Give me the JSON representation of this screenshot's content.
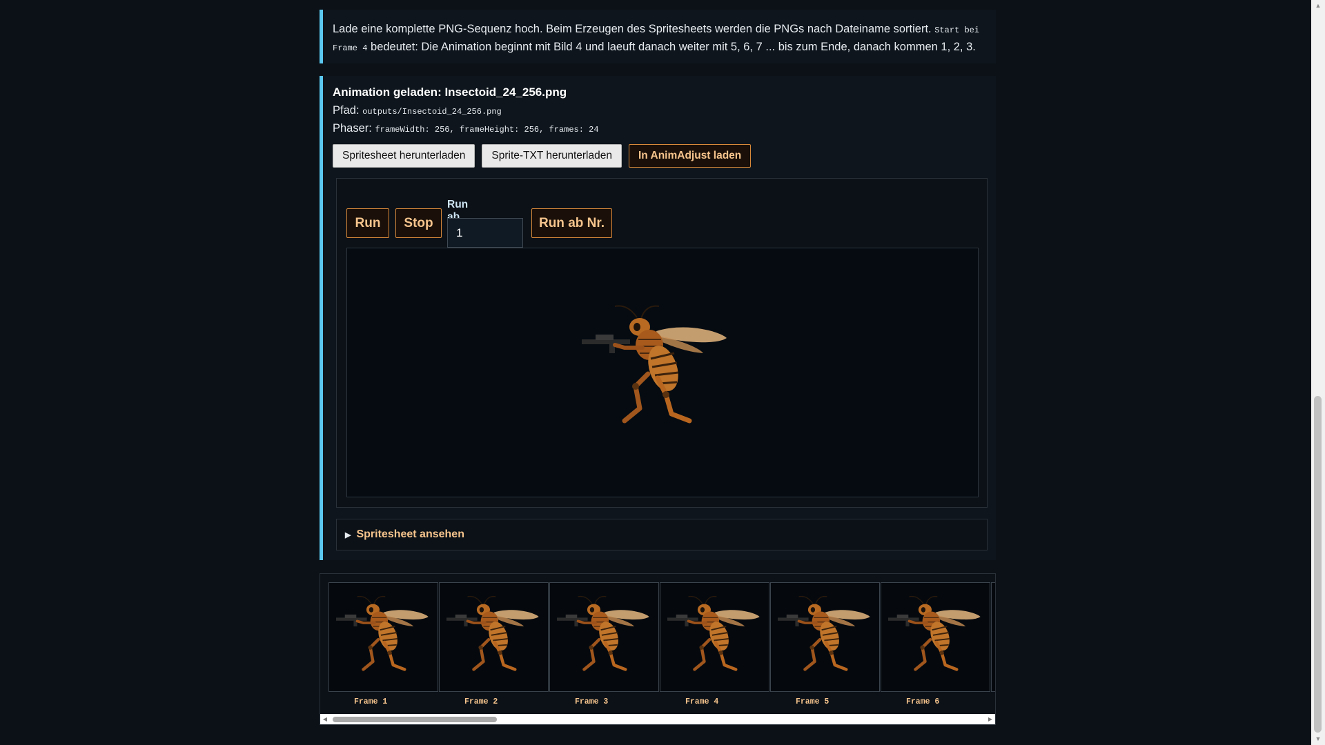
{
  "info": {
    "text_1": "Lade eine komplette PNG-Sequenz hoch. Beim Erzeugen des Spritesheets werden die PNGs nach Dateiname sortiert.",
    "code": "Start bei Frame 4",
    "text_2": "bedeutet: Die Animation beginnt mit Bild 4 und laeuft danach weiter mit 5, 6, 7 ... bis zum Ende, danach kommen 1, 2, 3."
  },
  "loaded": {
    "title": "Animation geladen: Insectoid_24_256.png",
    "path_label": "Pfad:",
    "path_value": "outputs/Insectoid_24_256.png",
    "phaser_label": "Phaser:",
    "phaser_value": "frameWidth: 256, frameHeight: 256, frames: 24",
    "buttons": {
      "download_sheet": "Spritesheet herunterladen",
      "download_txt": "Sprite-TXT herunterladen",
      "load_animadjust": "In AnimAdjust laden"
    }
  },
  "player": {
    "run_label": "Run",
    "stop_label": "Stop",
    "run_from_label": "Run ab Nr.",
    "run_from_button": "Run ab Nr.",
    "frame_number_value": "1"
  },
  "details": {
    "summary": "Spritesheet ansehen"
  },
  "frames": [
    {
      "label": "Frame 1"
    },
    {
      "label": "Frame 2"
    },
    {
      "label": "Frame 3"
    },
    {
      "label": "Frame 4"
    },
    {
      "label": "Frame 5"
    },
    {
      "label": "Frame 6"
    }
  ],
  "colors": {
    "accent_border": "#5bc8f0",
    "button_orange": "#d9893a",
    "label_orange": "#f6c48d",
    "background": "#0b1117"
  }
}
